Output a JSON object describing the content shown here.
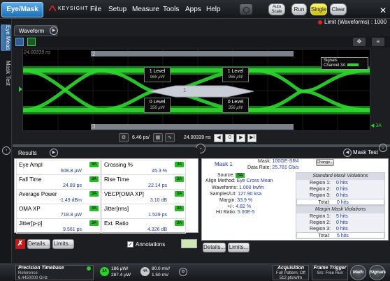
{
  "menubar": {
    "mode_button": "Eye/Mask",
    "brand": "KEYSIGHT",
    "menus": [
      "File",
      "Setup",
      "Measure",
      "Tools",
      "Apps",
      "Help"
    ],
    "auto_scale_line1": "Auto",
    "auto_scale_line2": "Scale",
    "run": "Run",
    "single": "Single",
    "clear": "Clear",
    "limit_status": "Limit (Waveforms) : 1000",
    "colors": {
      "accent": "#1f6fb6",
      "single": "#e8e020",
      "status_red": "#e02424"
    }
  },
  "side_tabs": [
    "Eye Meas",
    "Mask Test"
  ],
  "waveform": {
    "tab_label": "Waveform",
    "screen_time": "24.00339 ns",
    "top_bar_number": "2",
    "eye_number": "1",
    "bottom_bar_number": "3",
    "signals_title": "Signals",
    "signals_channel": "Channel 3A",
    "levels": [
      {
        "title": "1 Level",
        "value": "966 µW"
      },
      {
        "title": "1 Level",
        "value": "966 µW"
      },
      {
        "title": "0 Level",
        "value": "356 µW"
      },
      {
        "title": "0 Level",
        "value": "356 µW"
      }
    ],
    "channel_marker": "3A",
    "timebase_scale": "6.46 ps/",
    "timebase_position": "24.00339 ns",
    "nav_buttons": [
      "◀",
      "0",
      "▶",
      "▶I"
    ],
    "eye_color": "#2fd62f"
  },
  "results": {
    "tab_label": "Results",
    "cells": [
      {
        "name": "Eye Ampl",
        "value": "608.8 µW",
        "ch": "3A"
      },
      {
        "name": "Crossing %",
        "value": "45.3 %",
        "ch": "3A"
      },
      {
        "name": "Fall Time",
        "value": "24.89 ps",
        "ch": "3A"
      },
      {
        "name": "Rise Time",
        "value": "22.14 ps",
        "ch": "3A"
      },
      {
        "name": "Average Power",
        "value": "-1.49 dBm",
        "ch": "3A"
      },
      {
        "name": "VECP[OMA XP]",
        "value": "3.10 dB",
        "ch": "3A"
      },
      {
        "name": "OMA XP",
        "value": "718.8 µW",
        "ch": "3A"
      },
      {
        "name": "Jitter[rms]",
        "value": "1.529 ps",
        "ch": "3A"
      },
      {
        "name": "Jitter[p-p]",
        "value": "9.561 ps",
        "ch": "3A"
      },
      {
        "name": "Ext. Ratio",
        "value": "4.326 dB",
        "ch": "3A"
      }
    ],
    "details": "Details...",
    "limits": "Limits...",
    "annotations_label": "Annotations"
  },
  "mask_test": {
    "tab_label": "Mask Test",
    "mask_link": "Mask 1",
    "mask_label": "Mask:",
    "mask_value": "100GE-SR4",
    "change": "Change...",
    "data_rate_label": "Data Rate:",
    "data_rate_value": "25.781 Gb/s",
    "source_label": "Source:",
    "source_value": "3A",
    "align_label": "Align Method:",
    "align_value": "Eye Cross Mean",
    "waveforms_label": "Waveforms:",
    "waveforms_value": "1.000 kwfm",
    "samples_label": "Samples/UI:",
    "samples_value": "127.90 ksa",
    "margin_label": "Margin:",
    "margin_value": "33.9 %",
    "pm_label": "+/-:",
    "pm_value": "4.82 %",
    "hit_ratio_label": "Hit Ratio:",
    "hit_ratio_value": "5.00E-5",
    "standard_title": "Standard Mask Violations",
    "standard_rows": [
      {
        "label": "Region 1:",
        "value": "0 hits"
      },
      {
        "label": "Region 2:",
        "value": "0 hits"
      },
      {
        "label": "Region 3:",
        "value": "0 hits"
      },
      {
        "label": "Total:",
        "value": "0 hits"
      }
    ],
    "margin_title": "Margin Mask Violations",
    "margin_rows": [
      {
        "label": "Region 1:",
        "value": "5 hits"
      },
      {
        "label": "Region 2:",
        "value": "0 hits"
      },
      {
        "label": "Region 3:",
        "value": "0 hits"
      },
      {
        "label": "Total:",
        "value": "5 hits"
      }
    ],
    "details": "Details...",
    "limits": "Limits..."
  },
  "status": {
    "timebase_title": "Precision Timebase",
    "reference_label": "Reference:",
    "reference_value": "6.4450000 GHz",
    "ch3a_badge": "3A",
    "ch3a_line1": "186 µW/",
    "ch3a_line2": "287.4 µW",
    "ch4a_badge": "4A",
    "ch4a_line1": "80.0 mV/",
    "ch4a_line2": "1.50 mV",
    "acquisition_title": "Acquisition",
    "acquisition_line1": "Full Pattern: Off",
    "acquisition_line2": "512 pts/wfm",
    "trigger_title": "Frame Trigger",
    "trigger_line1": "Src: Free Run",
    "math": "Math",
    "signals": "Signals"
  }
}
